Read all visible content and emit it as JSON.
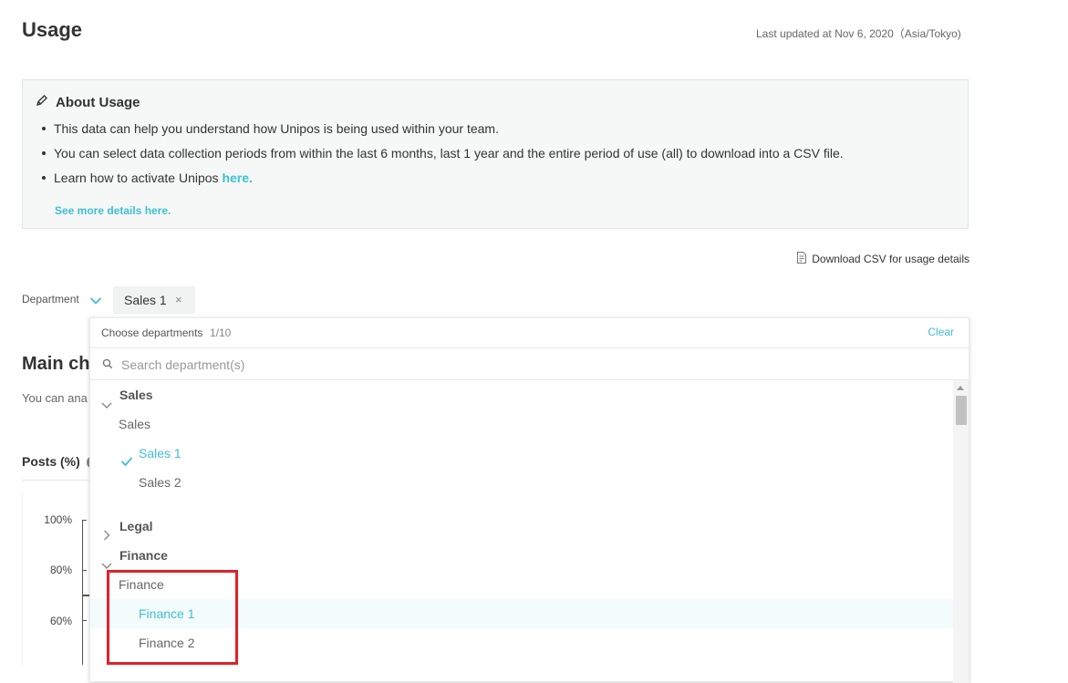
{
  "page": {
    "title": "Usage",
    "last_updated": "Last updated at Nov 6, 2020（Asia/Tokyo)"
  },
  "about": {
    "heading": "About Usage",
    "bullet1": "This data can help you understand how Unipos is being used within your team.",
    "bullet2": "You can select data collection periods from within the last 6 months, last 1 year and the entire period of use (all) to download into a CSV file.",
    "bullet3_text": "Learn how to activate Unipos ",
    "bullet3_link": "here.",
    "see_more": "See more details here.",
    "icons": {
      "heading": "pencil-icon"
    }
  },
  "download": {
    "label": "Download CSV for usage details",
    "icon": "csv-file-icon"
  },
  "filter": {
    "label": "Department",
    "chip_label": "Sales 1",
    "chip_remove": "×"
  },
  "background": {
    "main_title": "Main cha",
    "main_desc": "You can ana",
    "posts_label": "Posts (%)",
    "y_ticks": [
      "100%",
      "80%",
      "60%"
    ]
  },
  "dropdown": {
    "header_label": "Choose departments",
    "count": "1/10",
    "clear": "Clear",
    "search_placeholder": "Search department(s)",
    "accent": "#3ebfd3",
    "groups": [
      {
        "name": "Sales",
        "expanded": true,
        "parent": "Sales",
        "children": [
          {
            "name": "Sales 1",
            "selected": true
          },
          {
            "name": "Sales 2",
            "selected": false
          }
        ]
      },
      {
        "name": "Legal",
        "expanded": false
      },
      {
        "name": "Finance",
        "expanded": true,
        "parent": "Finance",
        "children": [
          {
            "name": "Finance 1",
            "selected": false,
            "highlighted": true
          },
          {
            "name": "Finance 2",
            "selected": false
          }
        ]
      }
    ]
  },
  "highlight_box_color": "#e0202a"
}
